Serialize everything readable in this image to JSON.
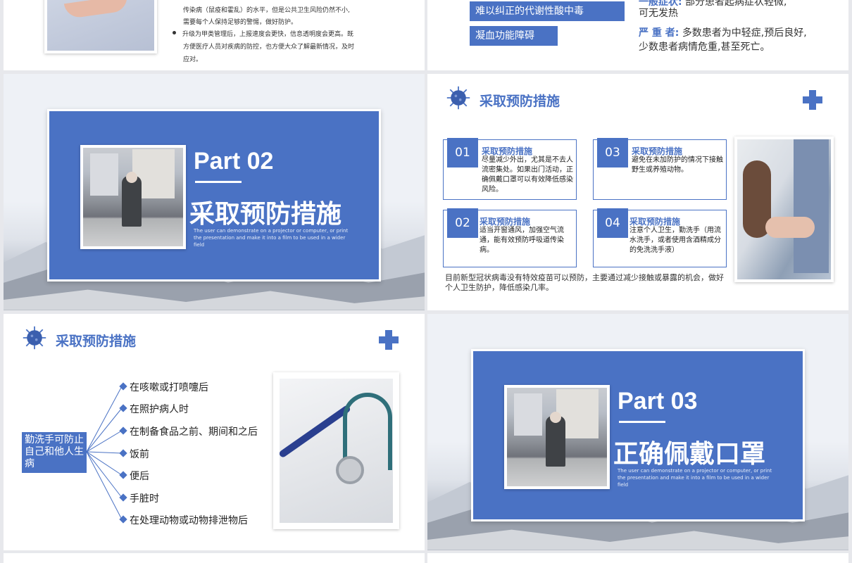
{
  "slide1": {
    "lines": [
      "传染病（鼠疫和霍乱）的水平，但是公共卫生风险仍然不小,",
      "需要每个人保持足够的警惕，做好防护。"
    ],
    "bullet": "升级为甲类管理后，上报速度会更快，信息透明度会更高。既",
    "bullet_lines": [
      "方便医疗人员对疾病的防控，也方便大众了解最新情况，及时",
      "应对。"
    ]
  },
  "slide2": {
    "pill1": "难以纠正的代谢性酸中毒",
    "pill2": "凝血功能障碍",
    "top_label": "一般症状:",
    "top_text": "部分患者起病症状轻微,",
    "top_text2": "可无发热",
    "severe_label": "严 重 者:",
    "severe_text": "多数患者为中轻症,预后良好,",
    "severe_text2": "少数患者病情危重,甚至死亡。"
  },
  "slide3": {
    "part": "Part 02",
    "title": "采取预防措施",
    "desc": "The user can demonstrate on a projector or computer, or print the presentation and make it into a film to be used in a wider field"
  },
  "slide4": {
    "title": "采取预防措施",
    "cards": [
      {
        "num": "01",
        "title": "采取预防措施",
        "body": "尽量减少外出，尤其是不去人流密集处。如果出门活动，正确佩戴口罩可以有效降低感染风险。"
      },
      {
        "num": "03",
        "title": "采取预防措施",
        "body": "避免在未加防护的情况下接触野生或养殖动物。"
      },
      {
        "num": "02",
        "title": "采取预防措施",
        "body": "适当开窗通风，加强空气流通，能有效预防呼吸道传染病。"
      },
      {
        "num": "04",
        "title": "采取预防措施",
        "body": "注意个人卫生，勤洗手（用流水洗手，或者使用含酒精成分的免洗洗手液）"
      }
    ],
    "footer": "目前新型冠状病毒没有特效疫苗可以预防，主要通过减少接触或暴露的机会，做好个人卫生防护，降低感染几率。"
  },
  "slide5": {
    "title": "采取预防措施",
    "center": "勤洗手可防止自己和他人生病",
    "items": [
      "在咳嗽或打喷嚏后",
      "在照护病人时",
      "在制备食品之前、期间和之后",
      "饭前",
      "便后",
      "手脏时",
      "在处理动物或动物排泄物后"
    ]
  },
  "slide6": {
    "part": "Part 03",
    "title": "正确佩戴口罩",
    "desc": "The user can demonstrate on a projector or computer, or print the presentation and make it into a film to be used in a wider field"
  },
  "colors": {
    "accent": "#4a72c4",
    "background": "#e7e8ec"
  }
}
